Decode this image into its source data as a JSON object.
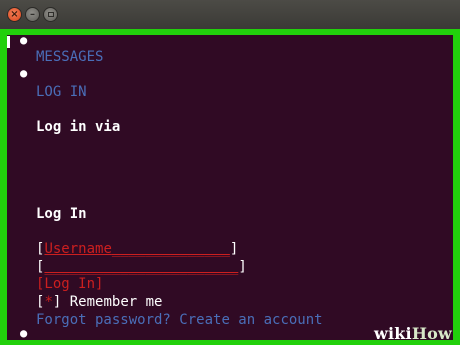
{
  "window": {
    "close_glyph": "×",
    "min_glyph": "–"
  },
  "nav": {
    "messages": "MESSAGES",
    "login_link": "LOG IN",
    "log_in_via": "Log in via"
  },
  "form": {
    "heading": "Log In",
    "username_placeholder": "Username",
    "bracket_open": "[",
    "bracket_close": "]",
    "username_blank": "______________",
    "password_blank": "_______________________",
    "submit_label": "[Log In]",
    "remember_checkbox": "*",
    "remember_label": "Remember me",
    "forgot_password": "Forgot password?",
    "create_account": "Create an account"
  },
  "watermark": {
    "wiki": "wiki",
    "how": "How"
  },
  "colors": {
    "terminal_bg": "#300a24",
    "frame_highlight": "#22d00c",
    "link": "#4a6eb8",
    "form_red": "#cc1f1f"
  }
}
